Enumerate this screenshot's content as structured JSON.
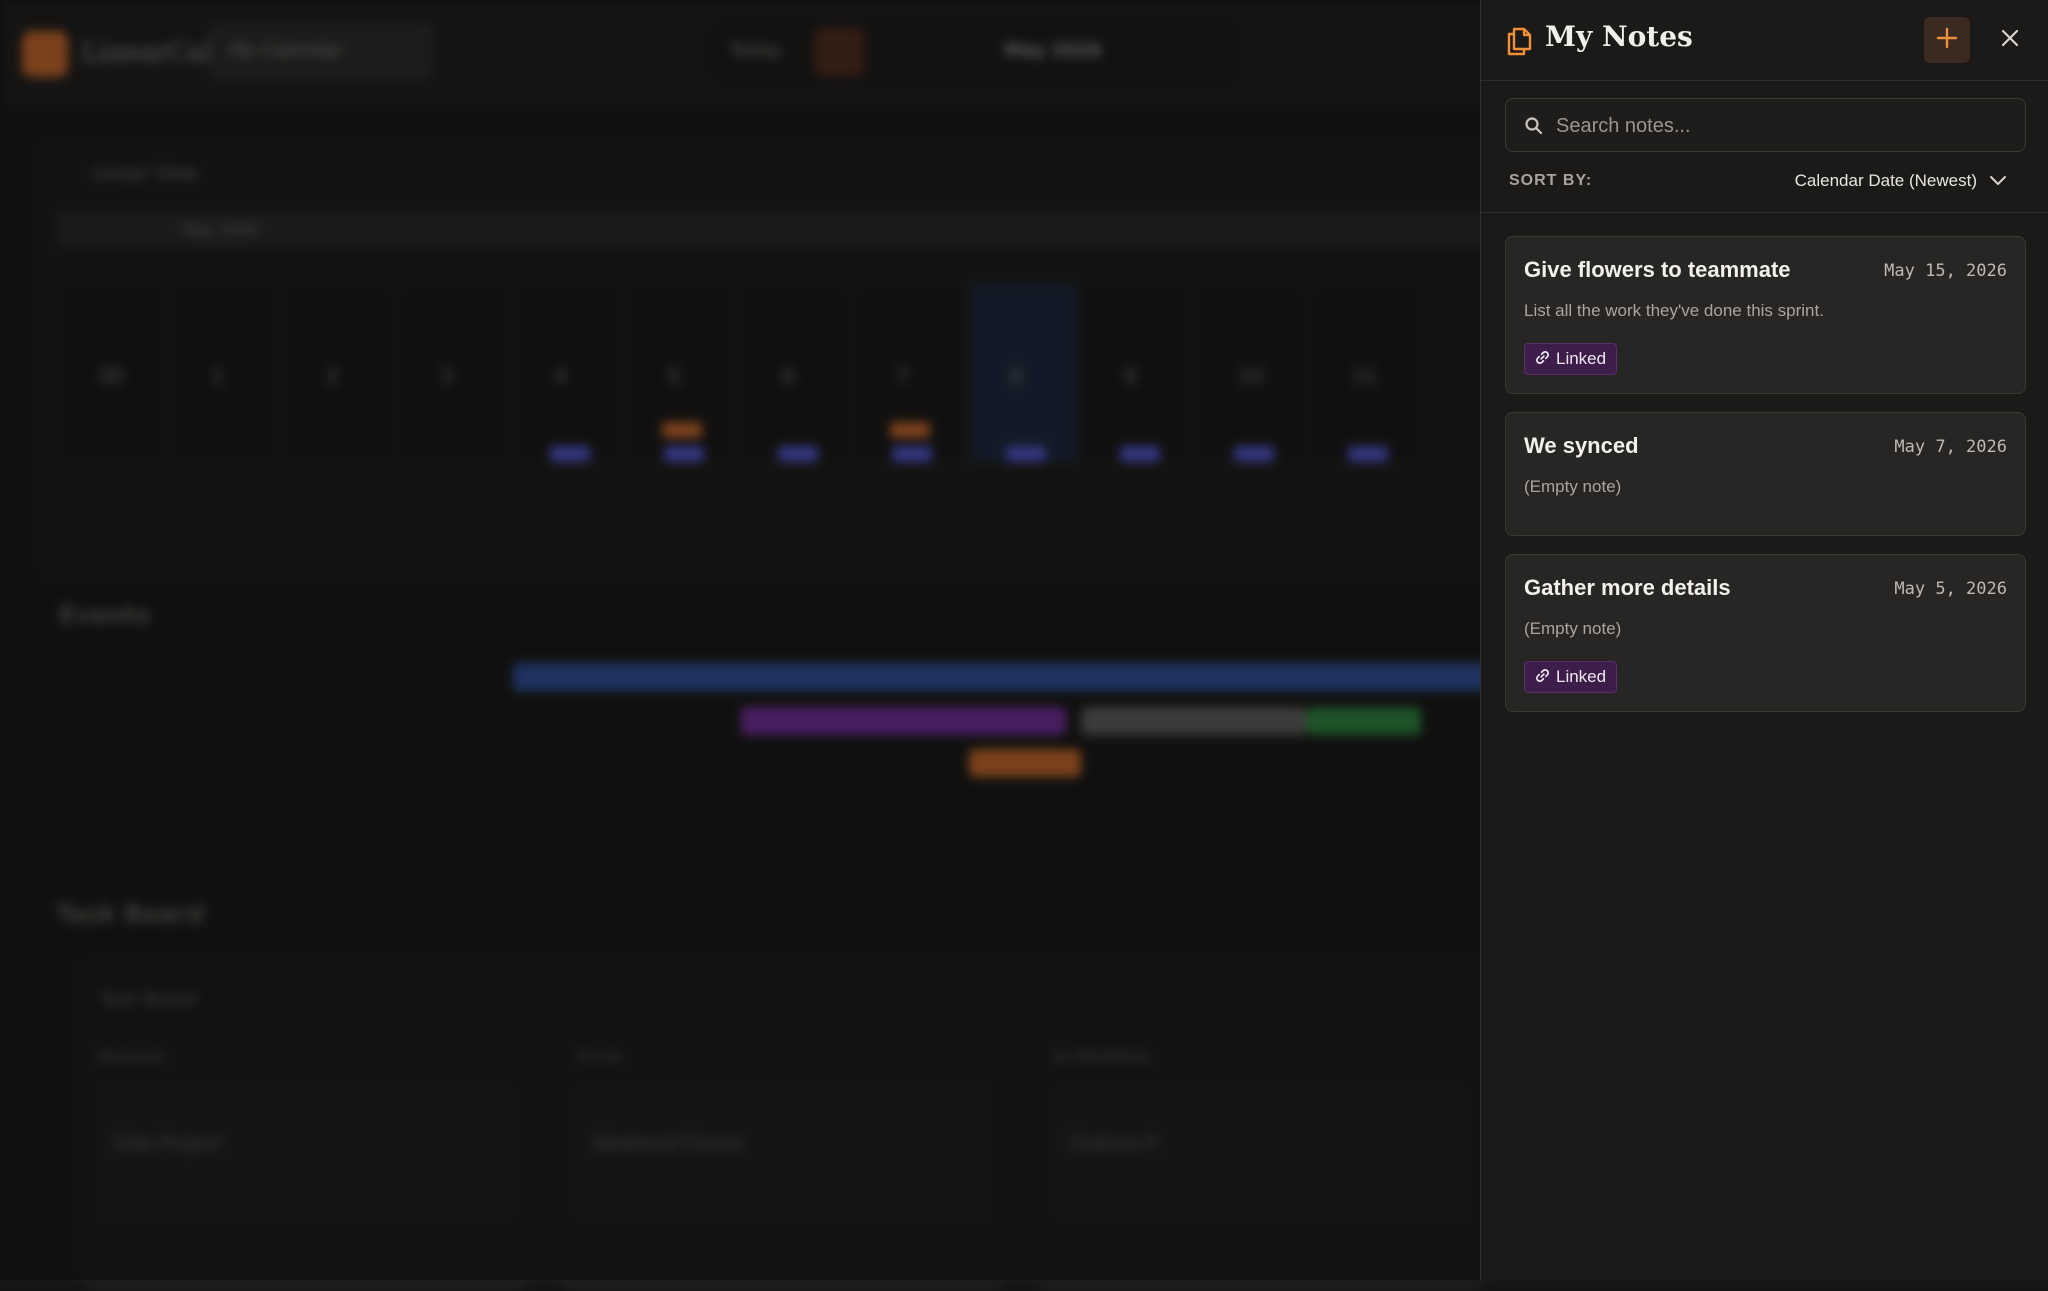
{
  "background": {
    "app_name": "LinearCal",
    "calendar_select": "My Calendar",
    "nav": {
      "today": "Today",
      "month": "May 2026"
    },
    "linear_view_title": "Linear View",
    "month_strip": "May 2026",
    "days": [
      "30",
      "1",
      "2",
      "3",
      "4",
      "5",
      "6",
      "7",
      "8",
      "9",
      "10",
      "11"
    ],
    "events_title": "Events",
    "task_board_title": "Task Board",
    "task_board_inner_title": "Task Board",
    "columns": [
      "BACKLOG",
      "TO DO",
      "IN PROGRESS"
    ],
    "cards": [
      "Side Project",
      "Weekend Chores",
      "Feature X"
    ]
  },
  "drawer": {
    "title": "My Notes",
    "title_icon": "notes-icon",
    "add_icon": "plus-icon",
    "close_icon": "close-icon",
    "search": {
      "placeholder": "Search notes...",
      "value": ""
    },
    "sort": {
      "label": "SORT BY:",
      "value": "Calendar Date (Newest)"
    },
    "notes": [
      {
        "title": "Give flowers to teammate",
        "date": "May 15, 2026",
        "body": "List all the work they've done this sprint.",
        "linked": true,
        "badge": "Linked"
      },
      {
        "title": "We synced",
        "date": "May 7, 2026",
        "body": "(Empty note)",
        "linked": false,
        "badge": ""
      },
      {
        "title": "Gather more details",
        "date": "May 5, 2026",
        "body": "(Empty note)",
        "linked": true,
        "badge": "Linked"
      }
    ],
    "colors": {
      "accent": "#f0903a",
      "badge_bg": "#3d1e4a",
      "drawer_bg": "#1b1a19",
      "card_bg": "#282625"
    }
  }
}
